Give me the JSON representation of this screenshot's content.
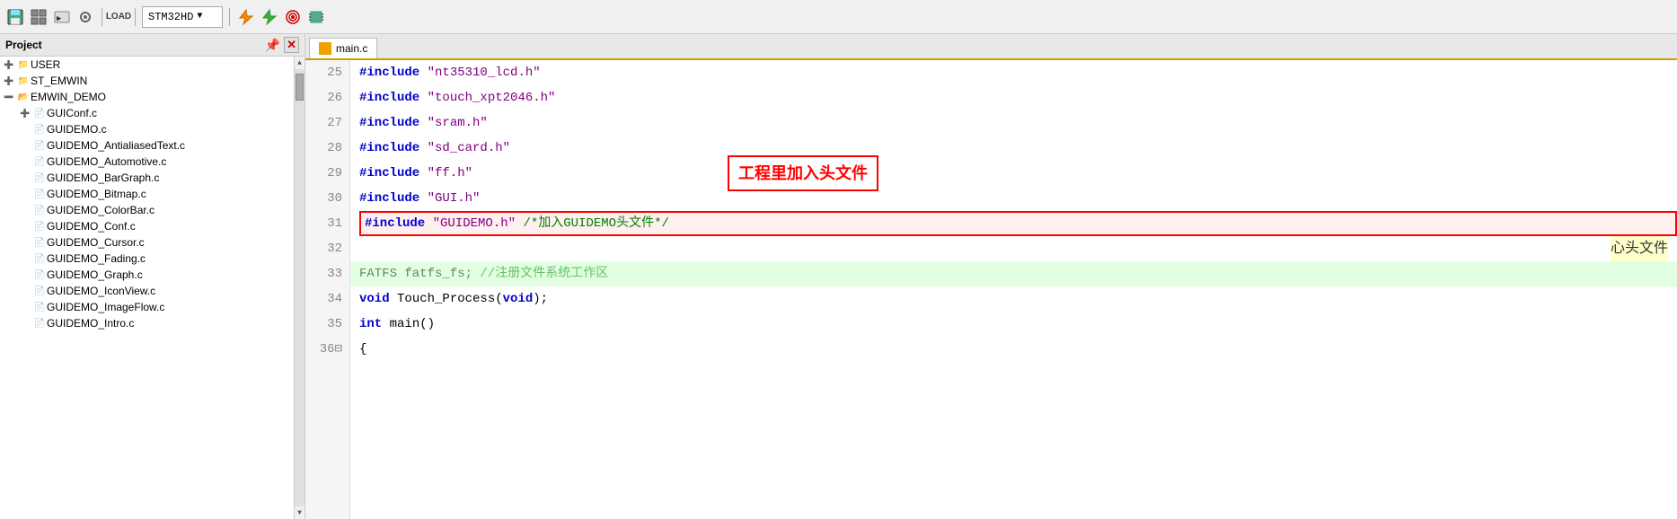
{
  "toolbar": {
    "title": "STM32HD",
    "buttons": [
      "save-icon",
      "build-icon",
      "debug-icon",
      "flash-icon",
      "target-icon",
      "load-icon"
    ],
    "dropdown_label": "STM32HD"
  },
  "sidebar": {
    "title": "Project",
    "items": [
      {
        "label": "USER",
        "type": "folder",
        "expanded": true,
        "indent": 0
      },
      {
        "label": "ST_EMWIN",
        "type": "folder",
        "expanded": false,
        "indent": 0
      },
      {
        "label": "EMWIN_DEMO",
        "type": "folder",
        "expanded": true,
        "indent": 0
      },
      {
        "label": "GUIConf.c",
        "type": "file",
        "expanded": false,
        "indent": 1
      },
      {
        "label": "GUIDEMO.c",
        "type": "file",
        "indent": 1
      },
      {
        "label": "GUIDEMO_AntialiasedText.c",
        "type": "file",
        "indent": 1
      },
      {
        "label": "GUIDEMO_Automotive.c",
        "type": "file",
        "indent": 1
      },
      {
        "label": "GUIDEMO_BarGraph.c",
        "type": "file",
        "indent": 1
      },
      {
        "label": "GUIDEMO_Bitmap.c",
        "type": "file",
        "indent": 1
      },
      {
        "label": "GUIDEMO_ColorBar.c",
        "type": "file",
        "indent": 1
      },
      {
        "label": "GUIDEMO_Conf.c",
        "type": "file",
        "indent": 1
      },
      {
        "label": "GUIDEMO_Cursor.c",
        "type": "file",
        "indent": 1
      },
      {
        "label": "GUIDEMO_Fading.c",
        "type": "file",
        "indent": 1
      },
      {
        "label": "GUIDEMO_Graph.c",
        "type": "file",
        "indent": 1
      },
      {
        "label": "GUIDEMO_IconView.c",
        "type": "file",
        "indent": 1
      },
      {
        "label": "GUIDEMO_ImageFlow.c",
        "type": "file",
        "indent": 1
      },
      {
        "label": "GUIDEMO_Intro.c",
        "type": "file",
        "indent": 1
      }
    ]
  },
  "tab": {
    "label": "main.c"
  },
  "code": {
    "lines": [
      {
        "num": 25,
        "content": "#include \"nt35310_lcd.h\"",
        "type": "include"
      },
      {
        "num": 26,
        "content": "#include \"touch_xpt2046.h\"",
        "type": "include"
      },
      {
        "num": 27,
        "content": "#include \"sram.h\"",
        "type": "include"
      },
      {
        "num": 28,
        "content": "#include \"sd_card.h\"",
        "type": "include"
      },
      {
        "num": 29,
        "content": "#include \"ff.h\"",
        "type": "include"
      },
      {
        "num": 30,
        "content": "#include \"GUI.h\"",
        "type": "include"
      },
      {
        "num": 31,
        "content": "#include \"GUIDEMO.h\" /*加入GUIDEMO头文件*/",
        "type": "include-highlight"
      },
      {
        "num": 32,
        "content": "",
        "type": "blank"
      },
      {
        "num": 33,
        "content": "FATFS fatfs_fs; //注册文件系统工作区",
        "type": "normal"
      },
      {
        "num": 34,
        "content": "void Touch_Process(void);",
        "type": "normal"
      },
      {
        "num": 35,
        "content": "int main()",
        "type": "normal"
      },
      {
        "num": 36,
        "content": "{",
        "type": "normal"
      }
    ]
  },
  "annotation": {
    "text": "工程里加入头文件",
    "side_text": "心头文件"
  }
}
